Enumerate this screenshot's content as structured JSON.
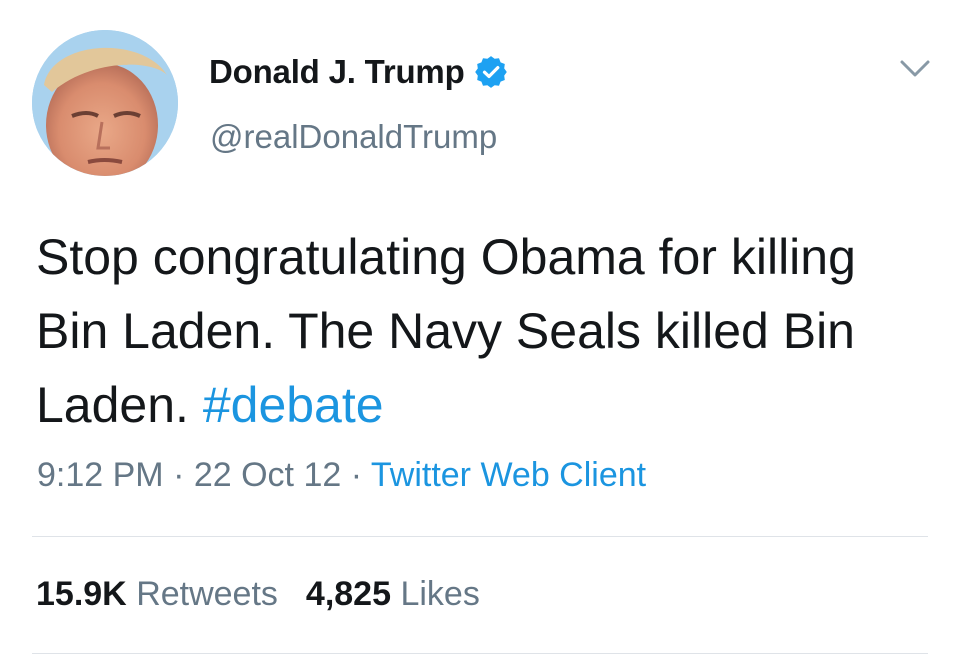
{
  "user": {
    "display_name": "Donald J. Trump",
    "handle": "@realDonaldTrump",
    "verified_icon": "verified-badge-icon"
  },
  "tweet": {
    "text": "Stop congratulating Obama for killing Bin Laden. The Navy Seals killed Bin Laden. ",
    "hashtag": "#debate",
    "time": "9:12 PM",
    "separator": " · ",
    "date": "22 Oct 12",
    "source": "Twitter Web Client"
  },
  "stats": {
    "retweets_count": "15.9K",
    "retweets_label": "Retweets",
    "likes_count": "4,825",
    "likes_label": "Likes"
  },
  "colors": {
    "link": "#1b95e0",
    "secondary_text": "#657786",
    "primary_text": "#14171a",
    "divider": "#dfe3e8"
  }
}
